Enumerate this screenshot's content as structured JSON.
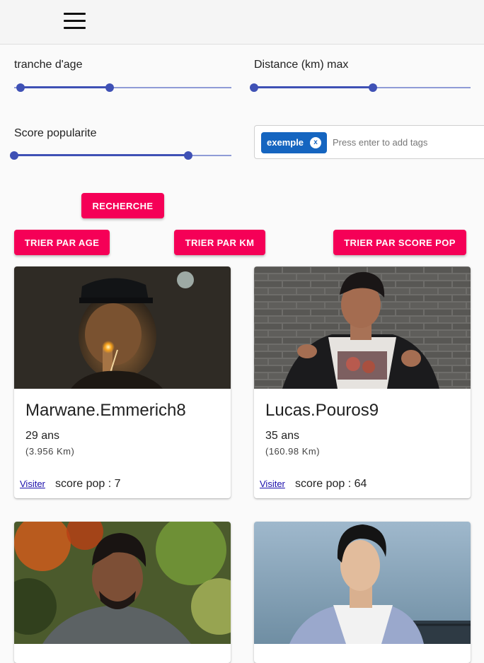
{
  "filters": {
    "age_label": "tranche d'age",
    "age_range": [
      0.03,
      0.44
    ],
    "distance_label": "Distance (km) max",
    "distance_range": [
      0.0,
      0.55
    ],
    "popularity_label": "Score popularite",
    "popularity_range": [
      0.0,
      0.8
    ]
  },
  "tags": {
    "chip_label": "exemple",
    "chip_remove": "x",
    "input_placeholder": "Press enter to add tags"
  },
  "buttons": {
    "search": "RECHERCHE",
    "sort_age": "TRIER PAR AGE",
    "sort_km": "TRIER PAR KM",
    "sort_score": "TRIER PAR SCORE POP"
  },
  "profiles": [
    {
      "username": "Marwane.Emmerich8",
      "age": "29 ans",
      "distance": "(3.956 Km)",
      "visit_label": "Visiter",
      "score": "score pop : 7"
    },
    {
      "username": "Lucas.Pouros9",
      "age": "35 ans",
      "distance": "(160.98 Km)",
      "visit_label": "Visiter",
      "score": "score pop : 64"
    },
    {},
    {}
  ],
  "colors": {
    "accent": "#f50057",
    "slider": "#3f51b5",
    "chip": "#1565c0",
    "link": "#1a0dab"
  }
}
